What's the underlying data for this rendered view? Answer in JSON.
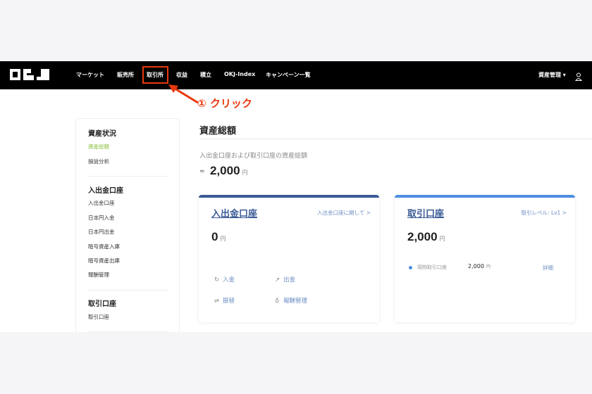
{
  "nav": {
    "logo": "OKJ",
    "items": [
      "マーケット",
      "販売所",
      "取引所",
      "収益",
      "積立",
      "OKJ-Index",
      "キャンペーン一覧"
    ],
    "asset_menu": "資産管理 ▾",
    "user_icon": "user-icon"
  },
  "annotation": {
    "label": "① クリック",
    "color": "#e8380d"
  },
  "sidebar": {
    "sections": [
      {
        "title": "資産状況",
        "items": [
          "資産総額",
          "損益分析"
        ],
        "active": "資産総額"
      },
      {
        "title": "入出金口座",
        "items": [
          "入出金口座",
          "日本円入金",
          "日本円出金",
          "暗号資産入庫",
          "暗号資産出庫",
          "報酬管理"
        ]
      },
      {
        "title": "取引口座",
        "items": [
          "取引口座"
        ]
      }
    ],
    "active_color": "#8cbf3f"
  },
  "main": {
    "title": "資産総額",
    "subtitle": "入出金口座および取引口座の資産総額",
    "approx": "≈",
    "total": "2,000",
    "unit": "円",
    "cards": [
      {
        "title": "入出金口座",
        "link": "入出金口座に関して >",
        "amount": "0",
        "unit": "円",
        "accent": "#3b5a96",
        "actions": [
          {
            "icon": "deposit-icon",
            "label": "入金"
          },
          {
            "icon": "withdraw-icon",
            "label": "出金"
          },
          {
            "icon": "transfer-icon",
            "label": "振替"
          },
          {
            "icon": "reward-icon",
            "label": "報酬管理"
          }
        ]
      },
      {
        "title": "取引口座",
        "link": "取引レベル: Lv1 >",
        "amount": "2,000",
        "unit": "円",
        "accent": "#4d8ee0",
        "row": {
          "label": "現物取引口座",
          "amount": "2,000",
          "unit": "円",
          "detail": "詳細"
        }
      }
    ]
  }
}
